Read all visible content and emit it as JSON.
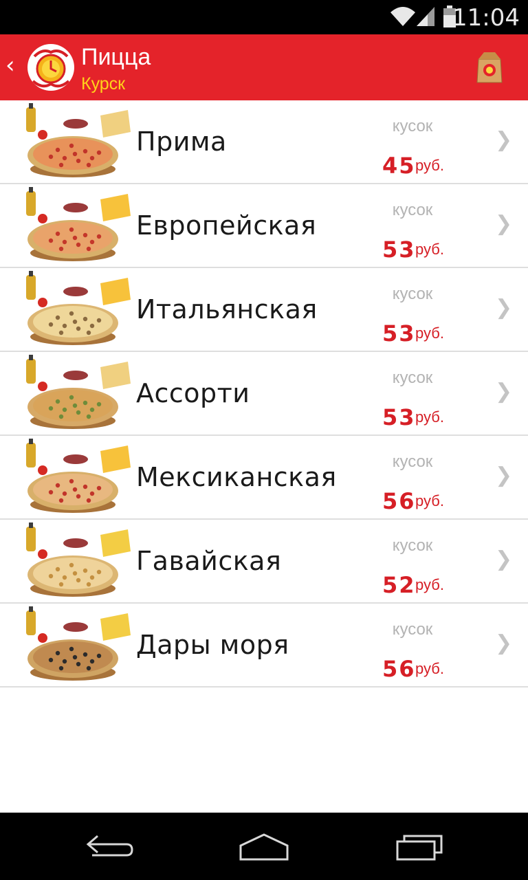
{
  "status_bar": {
    "time": "11:04"
  },
  "action_bar": {
    "title": "Пицца",
    "subtitle": "Курск"
  },
  "pizzas": [
    {
      "name": "Прима",
      "unit": "кусок",
      "price": "45",
      "currency": "руб.",
      "style": "prima"
    },
    {
      "name": "Европейская",
      "unit": "кусок",
      "price": "53",
      "currency": "руб.",
      "style": "euro"
    },
    {
      "name": "Итальянская",
      "unit": "кусок",
      "price": "53",
      "currency": "руб.",
      "style": "italian"
    },
    {
      "name": "Ассорти",
      "unit": "кусок",
      "price": "53",
      "currency": "руб.",
      "style": "assorti"
    },
    {
      "name": "Мексиканская",
      "unit": "кусок",
      "price": "56",
      "currency": "руб.",
      "style": "mexican"
    },
    {
      "name": "Гавайская",
      "unit": "кусок",
      "price": "52",
      "currency": "руб.",
      "style": "hawaii"
    },
    {
      "name": "Дары моря",
      "unit": "кусок",
      "price": "56",
      "currency": "руб.",
      "style": "sea"
    }
  ],
  "colors": {
    "accent": "#e4232a",
    "subtitle": "#ffd21a",
    "price": "#d61f26"
  },
  "icons": {
    "back": "chevron-left-icon",
    "cart": "shopping-bag-icon",
    "row": "chevron-right-icon"
  }
}
